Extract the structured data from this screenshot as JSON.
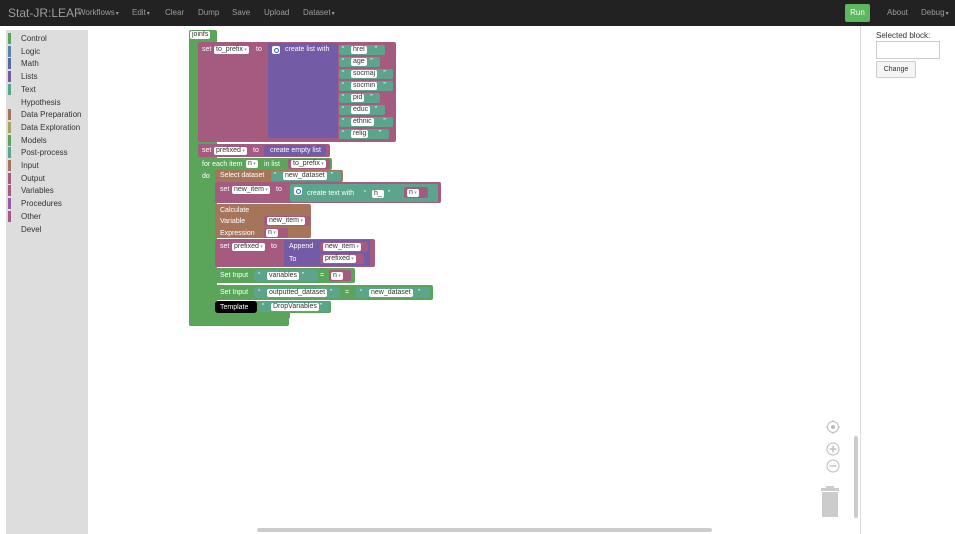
{
  "app": {
    "brand": "Stat-JR:LEAF",
    "menu": {
      "workflows": "Workflows",
      "edit": "Edit",
      "clear": "Clear",
      "dump": "Dump",
      "save": "Save",
      "upload": "Upload",
      "dataset": "Dataset"
    },
    "run": "Run",
    "about": "About",
    "debug": "Debug"
  },
  "toolbox": {
    "categories": [
      {
        "label": "Control",
        "color": "#5ba55b"
      },
      {
        "label": "Logic",
        "color": "#5b80a5"
      },
      {
        "label": "Math",
        "color": "#5b67a5"
      },
      {
        "label": "Lists",
        "color": "#745ba5"
      },
      {
        "label": "Text",
        "color": "#5ba58c"
      },
      {
        "label": "Hypothesis",
        "color": ""
      },
      {
        "label": "Data Preparation",
        "color": "#a5745b"
      },
      {
        "label": "Data Exploration",
        "color": "#a5a55b"
      },
      {
        "label": "Models",
        "color": "#5ba55b"
      },
      {
        "label": "Post-process",
        "color": "#5ba58c"
      },
      {
        "label": "Input",
        "color": "#a5745b"
      },
      {
        "label": "Output",
        "color": "#a55b80"
      },
      {
        "label": "Variables",
        "color": "#a55b80"
      },
      {
        "label": "Procedures",
        "color": "#995ba5"
      },
      {
        "label": "Other",
        "color": "#a55b80"
      },
      {
        "label": "Devel",
        "color": ""
      }
    ]
  },
  "right_panel": {
    "selected_label": "Selected block:",
    "selected_value": "",
    "change": "Change"
  },
  "workspace": {
    "func_name": "joinfs",
    "set_label": "set",
    "to_label": "to",
    "to_prefix_var": "to_prefix",
    "create_list_with": "create list with",
    "list_items": [
      "hrel",
      "age",
      "socmaj",
      "socmin",
      "pid",
      "educ",
      "ethnic",
      "relig"
    ],
    "prefixed_var": "prefixed",
    "create_empty_list": "create empty list",
    "for_each_item": "for each item",
    "loop_var": "n",
    "in_list": "in list",
    "do_label": "do",
    "select_dataset": "Select dataset",
    "new_dataset": "new_dataset",
    "new_item_var": "new_item",
    "create_text_with": "create text with",
    "text_prefix": "h_",
    "calculate": "Calculate",
    "variable_label": "Variable",
    "expression_label": "Expression",
    "append": "Append",
    "to_cap": "To",
    "set_input": "Set Input",
    "variables_str": "variables",
    "outputted_dataset": "outputted_dataset",
    "equals": "=",
    "template": "Template",
    "drop_variables": "DropVariables",
    "quote_open": "“",
    "quote_close": "”"
  },
  "colors": {
    "control": "#5ba55b",
    "variables": "#a55b80",
    "lists": "#745ba5",
    "text": "#5ba58c",
    "data_prep": "#a5745b"
  }
}
